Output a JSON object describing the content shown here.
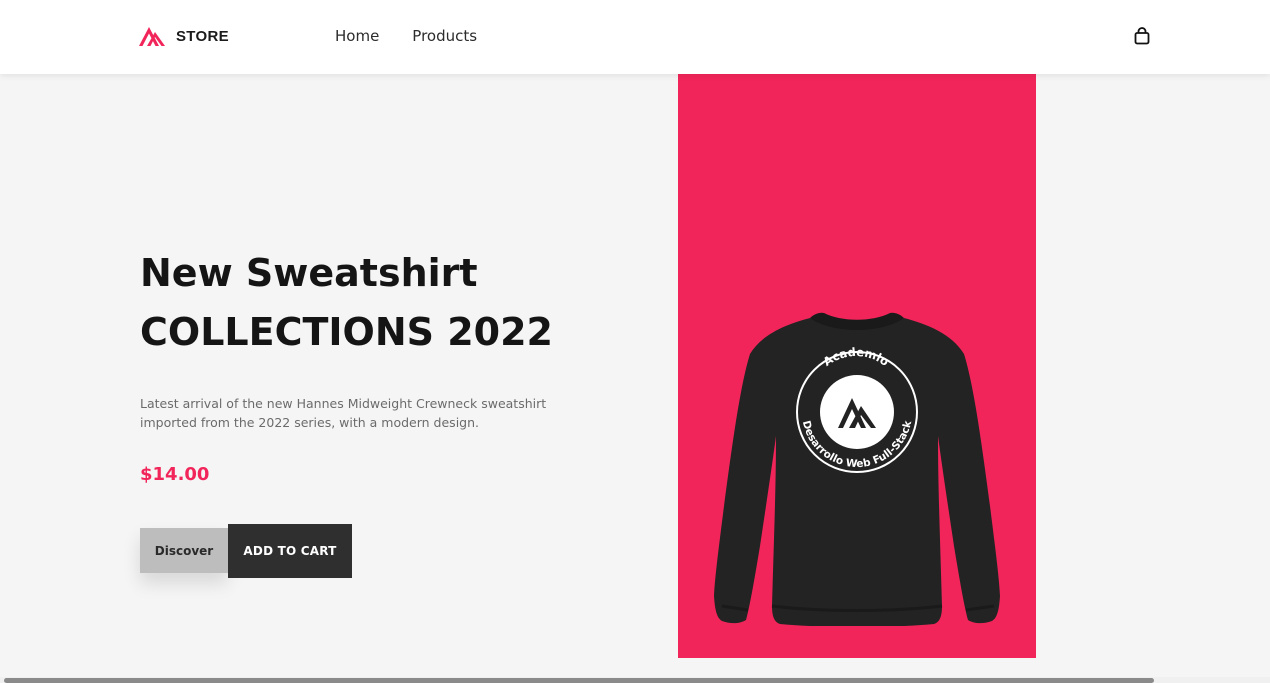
{
  "brand": {
    "name": "STORE",
    "logo_icon": "academlo-logo-icon",
    "accent_color": "#f2255a"
  },
  "nav": {
    "items": [
      {
        "label": "Home"
      },
      {
        "label": "Products"
      }
    ],
    "cart_icon": "shopping-bag-icon"
  },
  "hero": {
    "title_line1": "New Sweatshirt",
    "title_line2": "COLLECTIONS 2022",
    "description": "Latest arrival of the new Hannes Midweight Crewneck sweatshirt imported from the 2022 series, with a modern design.",
    "price": "$14.00",
    "discover_label": "Discover",
    "add_to_cart_label": "ADD TO CART"
  },
  "product_image": {
    "background_color": "#f2255a",
    "badge_top_text": "Academlo",
    "badge_bottom_text": "Desarrollo Web Full-Stack"
  }
}
